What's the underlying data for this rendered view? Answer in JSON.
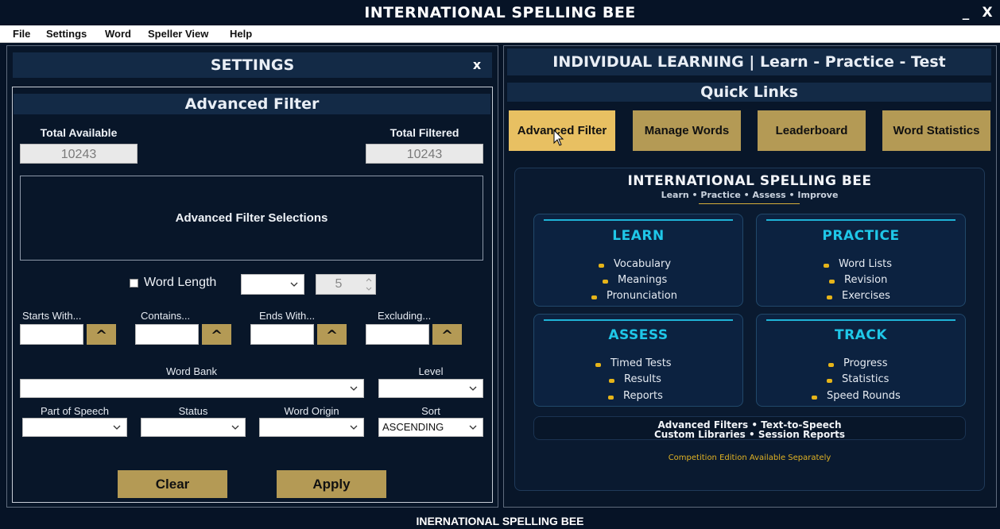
{
  "window": {
    "title": "INTERNATIONAL SPELLING BEE",
    "minimize_label": "_",
    "close_label": "X"
  },
  "menu": {
    "items": [
      "File",
      "Settings",
      "Word",
      "Speller View",
      "Help"
    ]
  },
  "settings": {
    "title": "SETTINGS",
    "close_label": "x",
    "advanced_filter": {
      "title": "Advanced Filter",
      "total_available_label": "Total Available",
      "total_available_value": "10243",
      "total_filtered_label": "Total Filtered",
      "total_filtered_value": "10243",
      "selections_label": "Advanced Filter Selections",
      "word_length_label": "Word Length",
      "word_length_checked": false,
      "word_length_value": "5",
      "starts_with_label": "Starts With...",
      "contains_label": "Contains...",
      "ends_with_label": "Ends With...",
      "excluding_label": "Excluding...",
      "caret_label": "^",
      "word_bank_label": "Word Bank",
      "level_label": "Level",
      "part_of_speech_label": "Part of Speech",
      "status_label": "Status",
      "word_origin_label": "Word Origin",
      "sort_label": "Sort",
      "sort_value": "ASCENDING",
      "clear_label": "Clear",
      "apply_label": "Apply"
    }
  },
  "learning": {
    "title": "INDIVIDUAL LEARNING | Learn - Practice - Test",
    "quick_links_title": "Quick Links",
    "quick_links": [
      "Advanced Filter",
      "Manage Words",
      "Leaderboard",
      "Word Statistics"
    ],
    "promo": {
      "title": "INTERNATIONAL SPELLING BEE",
      "subtitle": "Learn • Practice • Assess • Improve",
      "cards": [
        {
          "title": "LEARN",
          "items": [
            "Vocabulary",
            "Meanings",
            "Pronunciation"
          ]
        },
        {
          "title": "PRACTICE",
          "items": [
            "Word Lists",
            "Revision",
            "Exercises"
          ]
        },
        {
          "title": "ASSESS",
          "items": [
            "Timed Tests",
            "Results",
            "Reports"
          ]
        },
        {
          "title": "TRACK",
          "items": [
            "Progress",
            "Statistics",
            "Speed Rounds"
          ]
        }
      ],
      "features_line1": "Advanced Filters • Text-to-Speech",
      "features_line2": "Custom Libraries • Session Reports",
      "edition_note": "Competition Edition Available Separately"
    }
  },
  "footer": {
    "text": "INERNATIONAL SPELLING BEE"
  },
  "colors": {
    "background": "#061326",
    "header": "#132a46",
    "gold": "#b49a55",
    "gold_active": "#e8c062",
    "cyan": "#1fc7e8",
    "bullet": "#e6b419"
  }
}
